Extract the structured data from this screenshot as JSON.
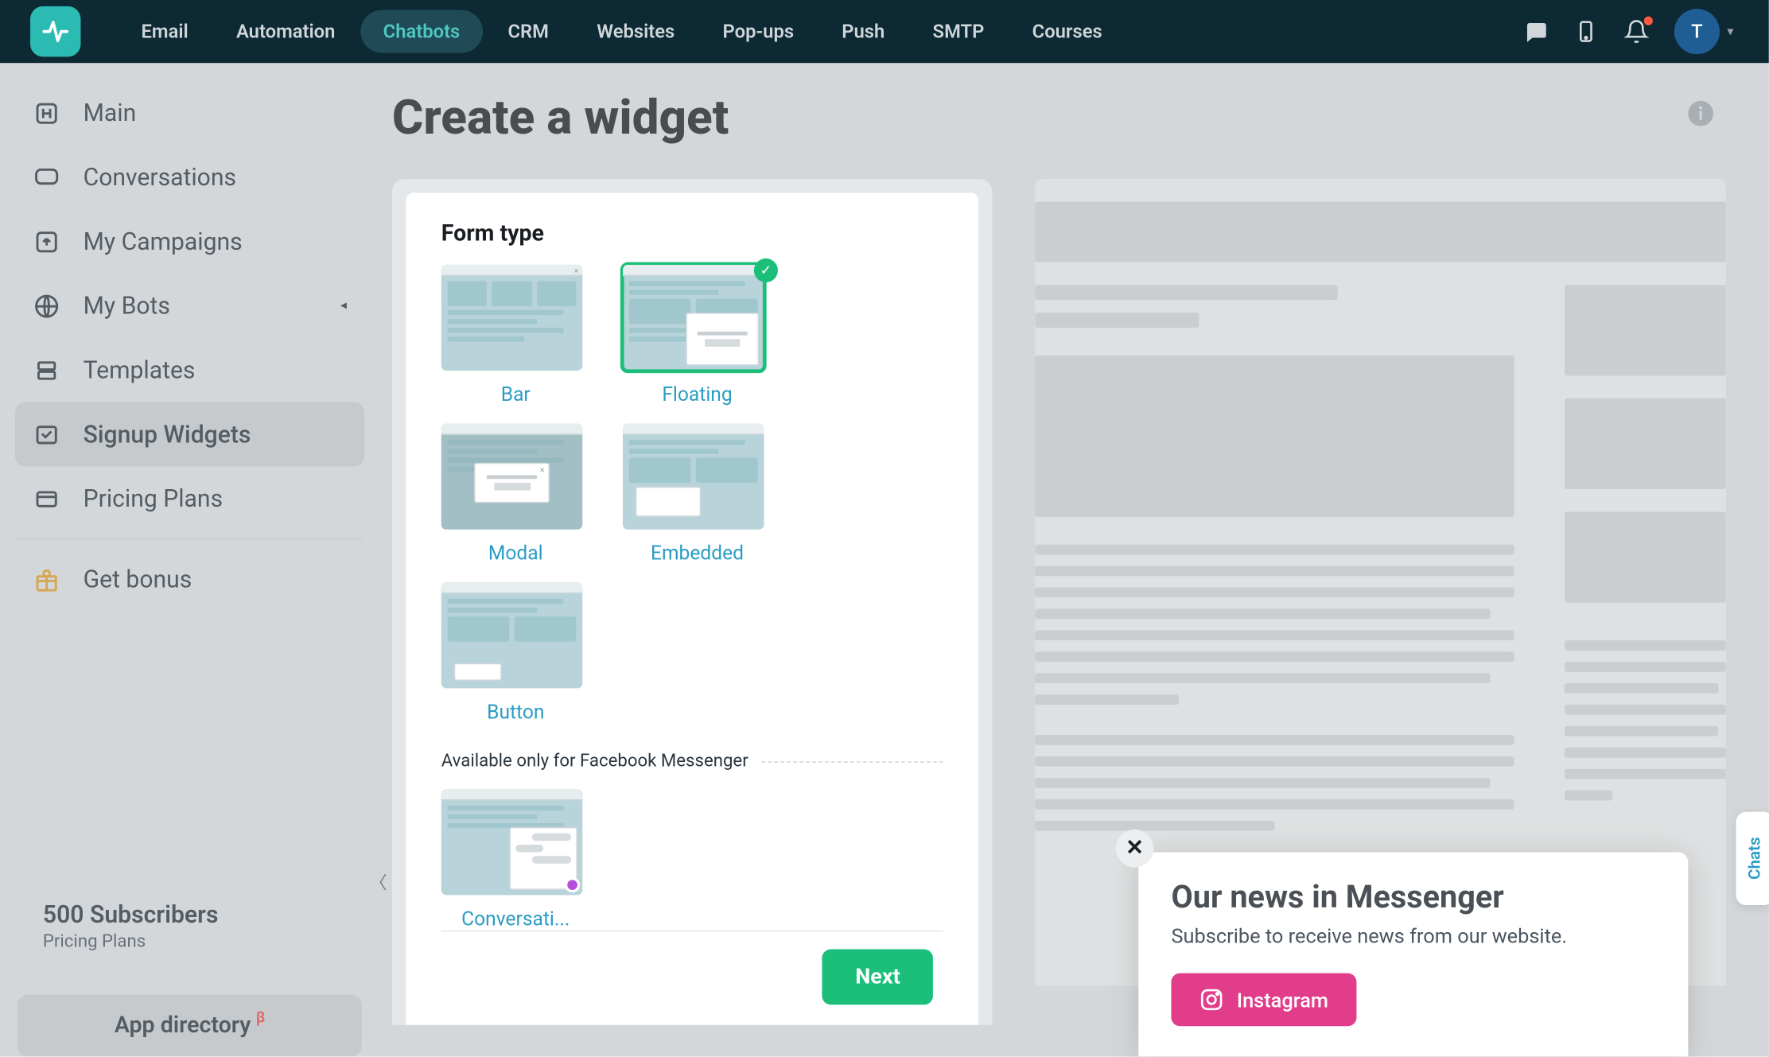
{
  "nav": {
    "items": [
      "Email",
      "Automation",
      "Chatbots",
      "CRM",
      "Websites",
      "Pop-ups",
      "Push",
      "SMTP",
      "Courses"
    ],
    "activeIndex": 2,
    "avatarInitial": "T"
  },
  "sidebar": {
    "items": [
      {
        "label": "Main",
        "icon": "home"
      },
      {
        "label": "Conversations",
        "icon": "chat"
      },
      {
        "label": "My Campaigns",
        "icon": "upload"
      },
      {
        "label": "My Bots",
        "icon": "globe",
        "chevron": true
      },
      {
        "label": "Templates",
        "icon": "layers"
      },
      {
        "label": "Signup Widgets",
        "icon": "widgets",
        "selected": true
      },
      {
        "label": "Pricing Plans",
        "icon": "card"
      }
    ],
    "bonus": "Get bonus",
    "subscribers": "500 Subscribers",
    "subscribersSub": "Pricing Plans",
    "appDirectory": "App directory",
    "beta": "β"
  },
  "page": {
    "title": "Create a widget"
  },
  "form": {
    "heading": "Form type",
    "options": [
      "Bar",
      "Floating",
      "Modal",
      "Embedded",
      "Button"
    ],
    "selectedIndex": 1,
    "fbOnly": "Available only for Facebook Messenger",
    "fbOption": "Conversati...",
    "next": "Next"
  },
  "messenger": {
    "title": "Our news in Messenger",
    "subtitle": "Subscribe to receive news from our website.",
    "instagram": "Instagram"
  },
  "chatsTab": "Chats"
}
